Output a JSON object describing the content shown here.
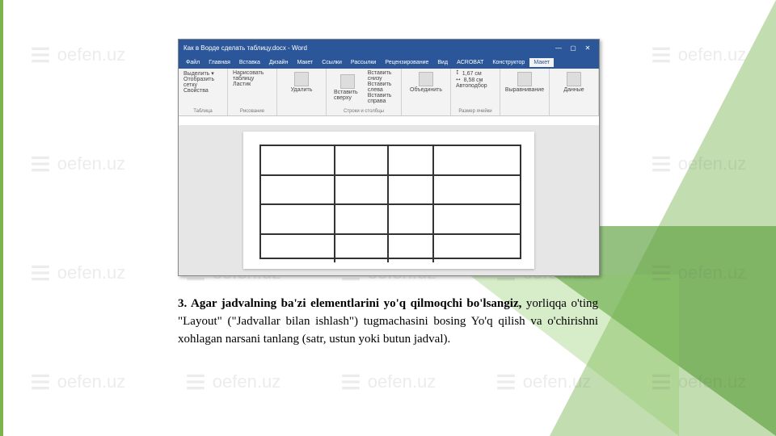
{
  "watermark": "oefen.uz",
  "screenshot": {
    "title": "Как в Ворде сделать таблицу.docx - Word",
    "win_min": "—",
    "win_max": "▢",
    "win_close": "✕",
    "tabs": [
      "Файл",
      "Главная",
      "Вставка",
      "Дизайн",
      "Макет",
      "Ссылки",
      "Рассылки",
      "Рецензирование",
      "Вид",
      "ACROBAT",
      "Конструктор",
      "Макет"
    ],
    "active_tab_index": 11,
    "groups": {
      "g1": {
        "b1": "Выделить ▾",
        "b2": "Отобразить сетку",
        "b3": "Свойства",
        "cap": "Таблица"
      },
      "g2": {
        "b1": "Нарисовать таблицу",
        "b2": "Ластик",
        "cap": "Рисование"
      },
      "g3": {
        "b1": "Удалить",
        "cap": ""
      },
      "g4": {
        "b1": "Вставить сверху",
        "r1": "Вставить снизу",
        "r2": "Вставить слева",
        "r3": "Вставить справа",
        "cap": "Строки и столбцы"
      },
      "g5": {
        "b1": "Объединить",
        "cap": ""
      },
      "g6": {
        "h": "1,67 см",
        "w": "8,58 см",
        "auto": "Автоподбор",
        "cap": "Размер ячейки"
      },
      "g7": {
        "b1": "Выравнивание",
        "cap": ""
      },
      "g8": {
        "b1": "Данные",
        "cap": ""
      }
    }
  },
  "paragraph": {
    "lead": "3. Agar jadvalning ba'zi elementlarini yo'q qilmoqchi bo'lsangiz, ",
    "rest": "yorliqqa o'ting \"Layout\" (\"Jadvallar bilan ishlash\") tugmachasini bosing Yo'q qilish va o'chirishni xohlagan narsani tanlang (satr, ustun yoki butun jadval)."
  }
}
